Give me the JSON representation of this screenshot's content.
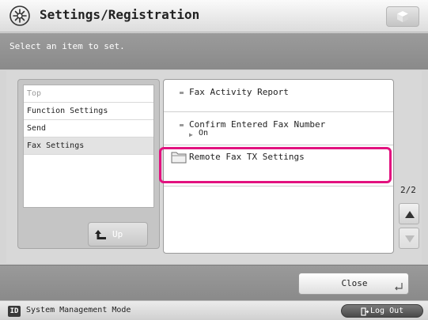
{
  "header": {
    "title": "Settings/Registration",
    "icon": "settings-gear-icon"
  },
  "instruction": "Select an item to set.",
  "breadcrumb": [
    {
      "label": "Top",
      "state": "dim"
    },
    {
      "label": "Function Settings",
      "state": "normal"
    },
    {
      "label": "Send",
      "state": "normal"
    },
    {
      "label": "Fax Settings",
      "state": "selected"
    }
  ],
  "up_button": {
    "label": "Up",
    "icon": "up-arrow-icon"
  },
  "settings_list": [
    {
      "label": "Fax Activity Report",
      "type": "setting"
    },
    {
      "label": "Confirm Entered Fax Number",
      "type": "setting",
      "value": "On"
    },
    {
      "label": "Remote Fax TX Settings",
      "type": "folder",
      "highlighted": true
    }
  ],
  "pagination": {
    "current": "2/2"
  },
  "footer": {
    "close_label": "Close"
  },
  "status_bar": {
    "badge": "ID",
    "mode_text": "System Management Mode",
    "logout_label": "Log Out"
  },
  "colors": {
    "highlight": "#e2127f",
    "header_bg": "#f0f0f0",
    "bar_bg": "#909090"
  }
}
